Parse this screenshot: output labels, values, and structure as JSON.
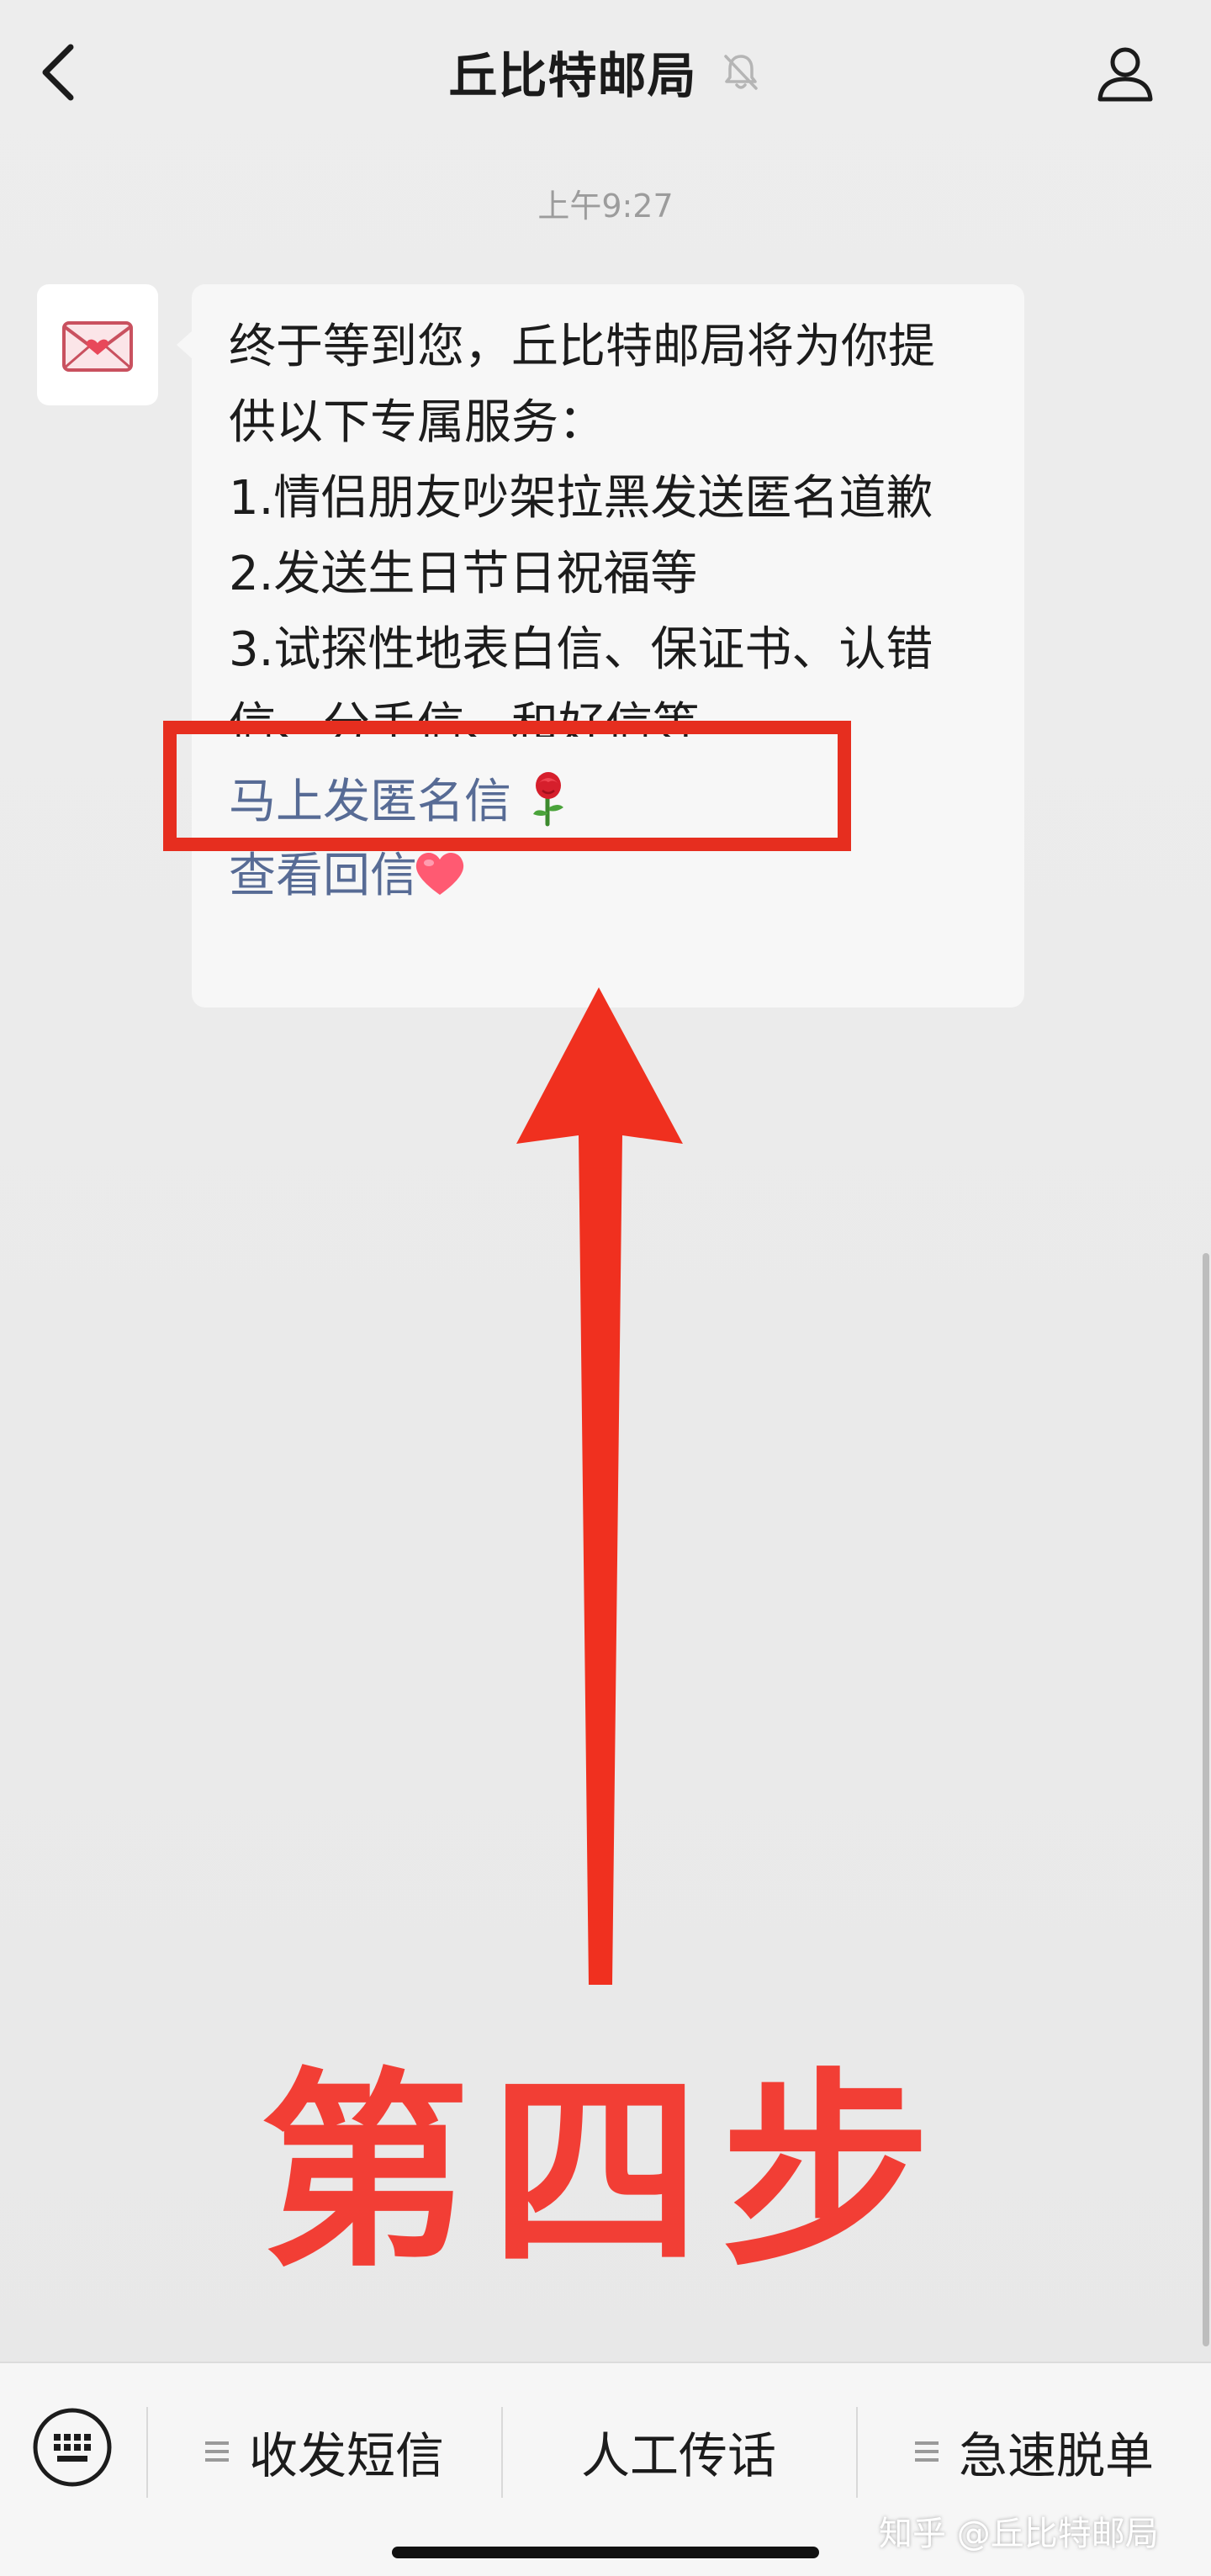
{
  "header": {
    "title": "丘比特邮局"
  },
  "chat": {
    "timestamp": "上午9:27",
    "message_lines": [
      "终于等到您，丘比特邮局将为你提",
      "供以下专属服务：",
      "1.情侣朋友吵架拉黑发送匿名道歉",
      "2.发送生日节日祝福等",
      "3.试探性地表白信、保证书、认错",
      "信、分手信、和好信等"
    ],
    "link_send": "马上发匿名信",
    "link_reply": "查看回信"
  },
  "annotation": {
    "step_label": "第四步",
    "color": "#e62e1f"
  },
  "bottom_menu": {
    "items": [
      {
        "label": "收发短信",
        "has_menu_icon": true
      },
      {
        "label": "人工传话",
        "has_menu_icon": false
      },
      {
        "label": "急速脱单",
        "has_menu_icon": true
      }
    ]
  },
  "watermark": "知乎 @丘比特邮局",
  "colors": {
    "link": "#576b95",
    "bubble": "#f7f7f7",
    "background": "#ececec"
  }
}
